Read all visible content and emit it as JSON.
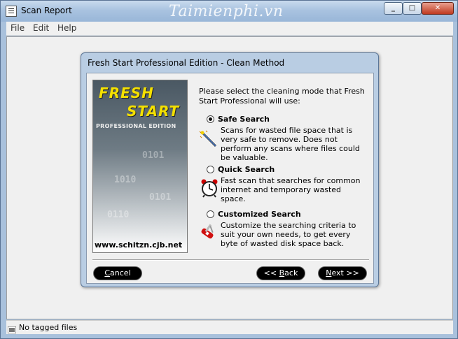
{
  "window": {
    "title": "Scan Report",
    "watermark": "Taimienphi.vn"
  },
  "menu": [
    "File",
    "Edit",
    "Help"
  ],
  "dialog": {
    "title": "Fresh Start Professional Edition  - Clean Method",
    "banner": {
      "line1": "FRESH",
      "line2": "START",
      "line3": "PROFESSIONAL EDITION",
      "url": "www.schitzn.cjb.net"
    },
    "prompt": "Please select the cleaning mode that Fresh Start Professional will use:",
    "options": [
      {
        "label": "Safe Search",
        "description": "Scans for wasted file space that is very safe to remove.  Does not perform any scans where files could be valuable.",
        "selected": true,
        "icon": "magic-wand-icon"
      },
      {
        "label": "Quick Search",
        "description": "Fast scan that searches for common internet and temporary wasted space.",
        "selected": false,
        "icon": "alarm-clock-icon"
      },
      {
        "label": "Customized Search",
        "description": "Customize the searching criteria to suit your own needs, to get every byte of wasted disk space back.",
        "selected": false,
        "icon": "swiss-knife-icon"
      }
    ],
    "buttons": {
      "cancel": {
        "first": "C",
        "rest": "ancel"
      },
      "back": {
        "pre": "<< ",
        "first": "B",
        "rest": "ack"
      },
      "next": {
        "first": "N",
        "rest": "ext >>"
      }
    }
  },
  "status": "No tagged files"
}
